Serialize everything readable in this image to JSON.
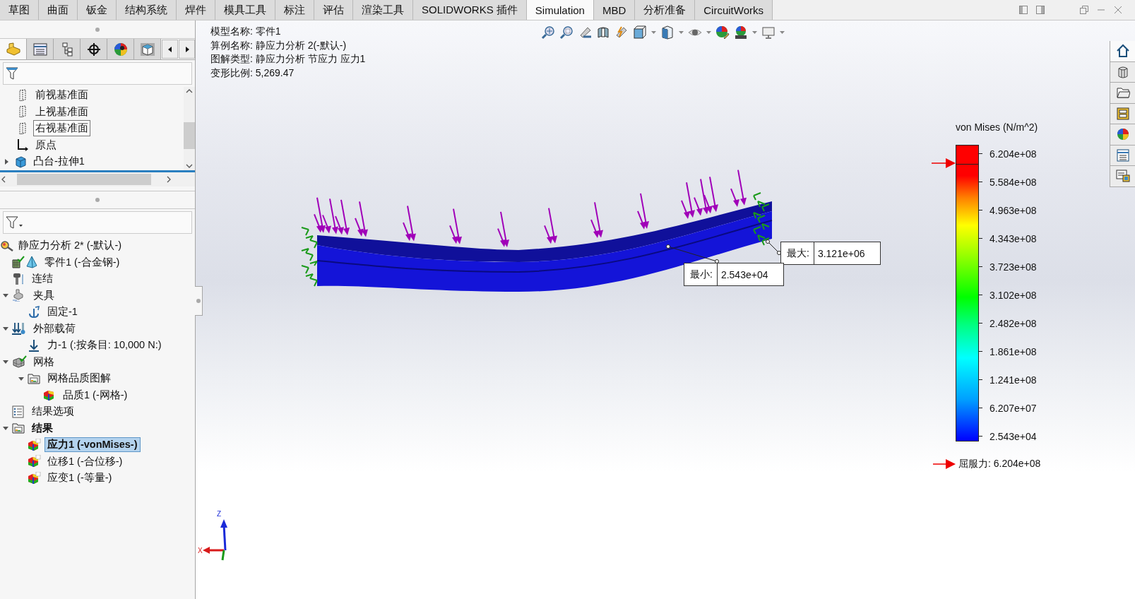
{
  "command_tabs": [
    {
      "label": "草图",
      "selected": false
    },
    {
      "label": "曲面",
      "selected": false
    },
    {
      "label": "钣金",
      "selected": false
    },
    {
      "label": "结构系统",
      "selected": false
    },
    {
      "label": "焊件",
      "selected": false
    },
    {
      "label": "模具工具",
      "selected": false
    },
    {
      "label": "标注",
      "selected": false
    },
    {
      "label": "评估",
      "selected": false
    },
    {
      "label": "渲染工具",
      "selected": false
    },
    {
      "label": "SOLIDWORKS 插件",
      "selected": false
    },
    {
      "label": "Simulation",
      "selected": true
    },
    {
      "label": "MBD",
      "selected": false
    },
    {
      "label": "分析准备",
      "selected": false
    },
    {
      "label": "CircuitWorks",
      "selected": false
    }
  ],
  "panel_tabs": [
    {
      "kind": "feature-manager",
      "selected": true
    },
    {
      "kind": "property-manager",
      "selected": false
    },
    {
      "kind": "configuration-manager",
      "selected": false
    },
    {
      "kind": "dimxpert",
      "selected": false
    },
    {
      "kind": "appearance",
      "selected": false
    },
    {
      "kind": "display-manager",
      "selected": false
    }
  ],
  "feature_tree": [
    {
      "kind": "plane",
      "label": "前视基准面",
      "selected": false
    },
    {
      "kind": "plane",
      "label": "上视基准面",
      "selected": false
    },
    {
      "kind": "plane",
      "label": "右视基准面",
      "selected": true
    },
    {
      "kind": "origin",
      "label": "原点",
      "selected": false
    },
    {
      "kind": "boss",
      "label": "凸台-拉伸1",
      "selected": false,
      "expanded": false
    }
  ],
  "study_tree": {
    "label": "静应力分析 2* (-默认-)",
    "children": [
      {
        "kind": "part",
        "label": "零件1 (-合金钢-)",
        "selected": false,
        "emphasized": false
      },
      {
        "kind": "connections",
        "label": "连结",
        "selected": false,
        "emphasized": false
      },
      {
        "kind": "fixtures",
        "label": "夹具",
        "selected": false,
        "emphasized": false,
        "expanded": true,
        "children": [
          {
            "kind": "fixed",
            "label": "固定-1",
            "selected": false,
            "emphasized": false
          }
        ]
      },
      {
        "kind": "loads",
        "label": "外部载荷",
        "selected": false,
        "emphasized": false,
        "expanded": true,
        "children": [
          {
            "kind": "force",
            "label": "力-1 (:按条目: 10,000 N:)",
            "selected": false,
            "emphasized": false
          }
        ]
      },
      {
        "kind": "mesh",
        "label": "网格",
        "selected": false,
        "emphasized": false,
        "expanded": true,
        "children": [
          {
            "kind": "plot-folder",
            "label": "网格品质图解",
            "selected": false,
            "emphasized": false,
            "expanded": true,
            "children": [
              {
                "kind": "quality",
                "label": "品质1 (-网格-)",
                "selected": false,
                "emphasized": false
              }
            ]
          }
        ]
      },
      {
        "kind": "options",
        "label": "结果选项",
        "selected": false,
        "emphasized": false
      },
      {
        "kind": "results-folder",
        "label": "结果",
        "selected": false,
        "emphasized": true,
        "expanded": true,
        "children": [
          {
            "kind": "stress",
            "label": "应力1 (-vonMises-)",
            "selected": true,
            "emphasized": true
          },
          {
            "kind": "displacement",
            "label": "位移1 (-合位移-)",
            "selected": false,
            "emphasized": false
          },
          {
            "kind": "strain",
            "label": "应变1 (-等量-)",
            "selected": false,
            "emphasized": false
          }
        ]
      }
    ]
  },
  "viewport": {
    "info": [
      "模型名称: 零件1",
      "算例名称: 静应力分析 2(-默认-)",
      "图解类型: 静应力分析 节应力 应力1",
      "变形比例: 5,269.47"
    ],
    "callouts": [
      {
        "kind": "max",
        "label": "最大:",
        "value": "3.121e+06"
      },
      {
        "kind": "min",
        "label": "最小:",
        "value": "2.543e+04"
      }
    ],
    "legend": {
      "title": "von Mises (N/m^2)",
      "ticks": [
        "6.204e+08",
        "5.584e+08",
        "4.963e+08",
        "4.343e+08",
        "3.723e+08",
        "3.102e+08",
        "2.482e+08",
        "1.861e+08",
        "1.241e+08",
        "6.207e+07",
        "2.543e+04"
      ],
      "yield": "屈服力: 6.204e+08"
    },
    "triad": {
      "z": "Z",
      "x": "X"
    }
  }
}
